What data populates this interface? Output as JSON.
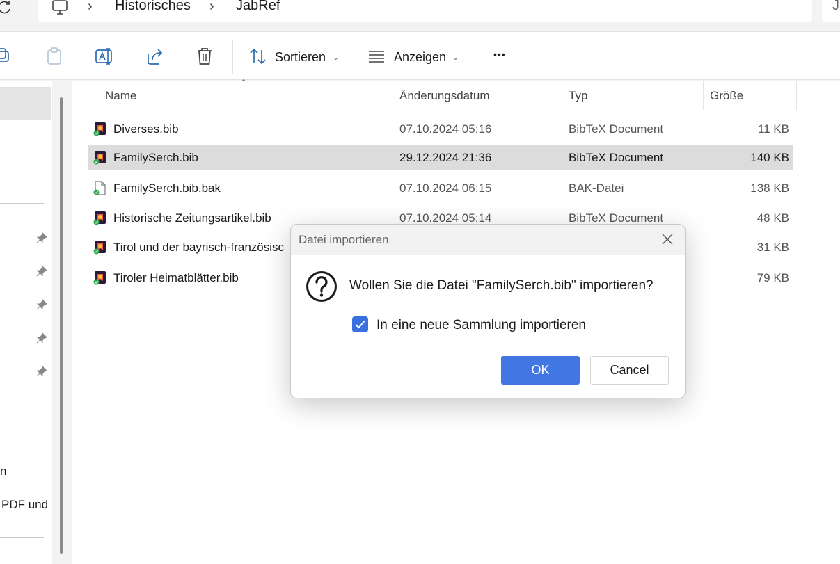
{
  "address_bar": {
    "refresh_icon": "refresh-icon",
    "pc_icon": "computer-icon",
    "breadcrumbs": [
      "Historisches",
      "JabRef"
    ],
    "separator": "›",
    "search_partial": "Ja"
  },
  "toolbar": {
    "icons": [
      "copy-icon",
      "paste-icon",
      "rename-icon",
      "share-icon",
      "delete-icon"
    ],
    "sort_label": "Sortieren",
    "view_label": "Anzeigen",
    "more_label": "•••"
  },
  "nav": {
    "items": [
      "n",
      "PDF und"
    ],
    "pin_icon": "pin-icon"
  },
  "columns": {
    "name": "Name",
    "date": "Änderungsdatum",
    "type": "Typ",
    "size": "Größe"
  },
  "files": [
    {
      "name": "Diverses.bib",
      "date": "07.10.2024 05:16",
      "type": "BibTeX Document",
      "size": "11 KB",
      "icon": "bibtex-file-icon"
    },
    {
      "name": "FamilySerch.bib",
      "date": "29.12.2024 21:36",
      "type": "BibTeX Document",
      "size": "140 KB",
      "icon": "bibtex-file-icon",
      "selected": true
    },
    {
      "name": "FamilySerch.bib.bak",
      "date": "07.10.2024 06:15",
      "type": "BAK-Datei",
      "size": "138 KB",
      "icon": "generic-file-icon"
    },
    {
      "name": "Historische Zeitungsartikel.bib",
      "date": "07.10.2024 05:14",
      "type": "BibTeX Document",
      "size": "48 KB",
      "icon": "bibtex-file-icon"
    },
    {
      "name": "Tirol und der bayrisch-französisc",
      "date": "",
      "type": "",
      "size": "31 KB",
      "icon": "bibtex-file-icon"
    },
    {
      "name": "Tiroler Heimatblätter.bib",
      "date": "",
      "type": "",
      "size": "79 KB",
      "icon": "bibtex-file-icon"
    }
  ],
  "dialog": {
    "title": "Datei importieren",
    "message": "Wollen Sie die Datei \"FamilySerch.bib\" importieren?",
    "checkbox_label": "In eine neue Sammlung importieren",
    "checkbox_checked": true,
    "ok_label": "OK",
    "cancel_label": "Cancel",
    "question_icon": "question-icon",
    "close_icon": "close-icon"
  },
  "colors": {
    "accent": "#4276e3",
    "selection": "#dcdcdc"
  }
}
